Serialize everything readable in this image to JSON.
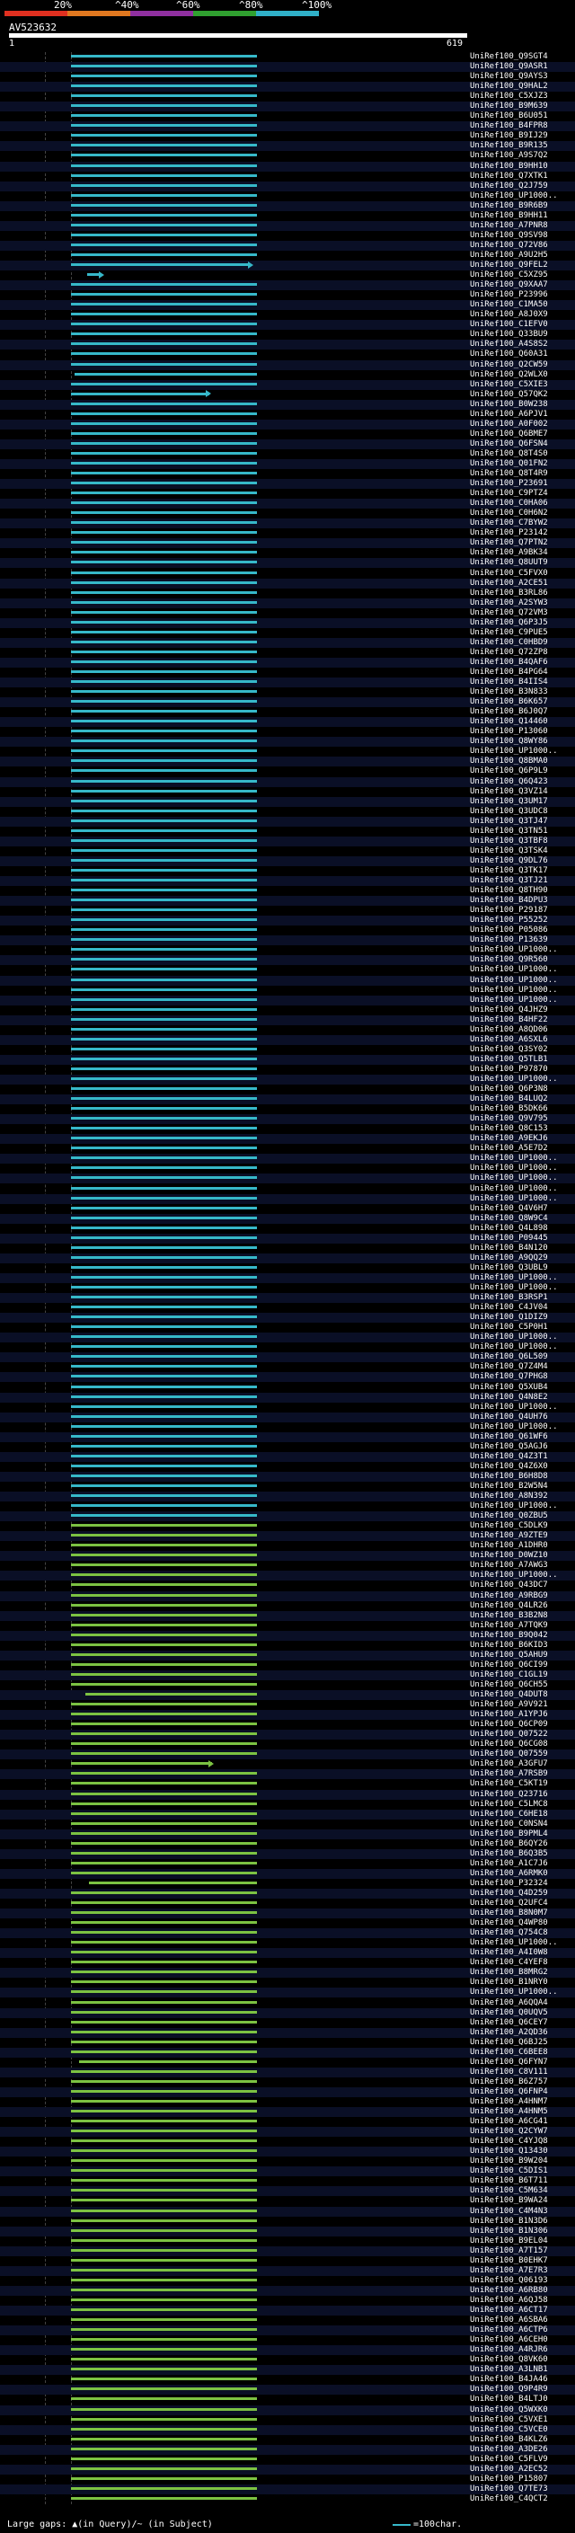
{
  "scale": {
    "labels": [
      "20%",
      "^40%",
      "^60%",
      "^80%",
      "^100%"
    ],
    "colors": [
      "#e03020",
      "#e07820",
      "#9030a0",
      "#30a030",
      "#30b0c8"
    ]
  },
  "query": {
    "id": "AV523632",
    "start": "1",
    "end": "619"
  },
  "legend": {
    "text": "Large gaps: ▲(in Query)/~ (in Subject)",
    "scale_text": "=100char."
  },
  "colors": {
    "cyan": "#36b8c9",
    "green": "#7cc242",
    "background": "#000000"
  },
  "hits": [
    "UniRef100_Q9SGT4",
    "UniRef100_Q9ASR1",
    "UniRef100_Q9AYS3",
    "UniRef100_Q9HAL2",
    "UniRef100_C5XJZ3",
    "UniRef100_B9M639",
    "UniRef100_B6U051",
    "UniRef100_B4FPR8",
    "UniRef100_B9IJ29",
    "UniRef100_B9R135",
    "UniRef100_A9S7Q2",
    "UniRef100_B9HH10",
    "UniRef100_Q7XTK1",
    "UniRef100_Q2J759",
    "UniRef100_UP1000..",
    "UniRef100_B9R6B9",
    "UniRef100_B9HH11",
    "UniRef100_A7PNR8",
    "UniRef100_Q9SV98",
    "UniRef100_Q72V86",
    "UniRef100_A9U2H5",
    "UniRef100_Q9FEL2",
    "UniRef100_C5XZ95",
    "UniRef100_Q9XAA7",
    "UniRef100_P23996",
    "UniRef100_C1MA50",
    "UniRef100_A8J0X9",
    "UniRef100_C1EFV0",
    "UniRef100_Q33BU9",
    "UniRef100_A4S8S2",
    "UniRef100_Q60A31",
    "UniRef100_Q2CW59",
    "UniRef100_Q2WLX0",
    "UniRef100_C5XIE3",
    "UniRef100_Q57QK2",
    "UniRef100_B0W238",
    "UniRef100_A6PJV1",
    "UniRef100_A0F002",
    "UniRef100_Q6BME7",
    "UniRef100_Q6FSN4",
    "UniRef100_Q8T4S0",
    "UniRef100_Q01FN2",
    "UniRef100_Q8T4R9",
    "UniRef100_P23691",
    "UniRef100_C9PTZ4",
    "UniRef100_C0HA06",
    "UniRef100_C0H6N2",
    "UniRef100_C7BYW2",
    "UniRef100_P23142",
    "UniRef100_Q7PTN2",
    "UniRef100_A9BK34",
    "UniRef100_Q8UUT9",
    "UniRef100_C5FVX0",
    "UniRef100_A2CE51",
    "UniRef100_B3RL86",
    "UniRef100_A2SYW3",
    "UniRef100_Q72VM3",
    "UniRef100_Q6P3J5",
    "UniRef100_C9PUE5",
    "UniRef100_C0HBD9",
    "UniRef100_Q72ZP8",
    "UniRef100_B4QAF6",
    "UniRef100_B4PG64",
    "UniRef100_B4IIS4",
    "UniRef100_B3N833",
    "UniRef100_B6K657",
    "UniRef100_B6J0Q7",
    "UniRef100_Q14460",
    "UniRef100_P13060",
    "UniRef100_Q8WY86",
    "UniRef100_UP1000..",
    "UniRef100_Q8BMA0",
    "UniRef100_Q6P9L9",
    "UniRef100_Q6Q423",
    "UniRef100_Q3VZ14",
    "UniRef100_Q3UM17",
    "UniRef100_Q3UDC8",
    "UniRef100_Q3TJ47",
    "UniRef100_Q3TN51",
    "UniRef100_Q3TBF8",
    "UniRef100_Q3TSK4",
    "UniRef100_Q9DL76",
    "UniRef100_Q3TK17",
    "UniRef100_Q3TJ21",
    "UniRef100_Q8TH90",
    "UniRef100_B4DPU3",
    "UniRef100_P29187",
    "UniRef100_P55252",
    "UniRef100_P05086",
    "UniRef100_P13639",
    "UniRef100_UP1000..",
    "UniRef100_Q9R560",
    "UniRef100_UP1000..",
    "UniRef100_UP1000..",
    "UniRef100_UP1000..",
    "UniRef100_UP1000..",
    "UniRef100_Q4JHZ9",
    "UniRef100_B4HF22",
    "UniRef100_A8QD06",
    "UniRef100_A6SXL6",
    "UniRef100_Q3SY02",
    "UniRef100_Q5TLB1",
    "UniRef100_P97870",
    "UniRef100_UP1000..",
    "UniRef100_Q6P3N8",
    "UniRef100_B4LUQ2",
    "UniRef100_B5DK66",
    "UniRef100_Q9V795",
    "UniRef100_Q8C153",
    "UniRef100_A9EKJ6",
    "UniRef100_A5E7D2",
    "UniRef100_UP1000..",
    "UniRef100_UP1000..",
    "UniRef100_UP1000..",
    "UniRef100_UP1000..",
    "UniRef100_UP1000..",
    "UniRef100_Q4V6H7",
    "UniRef100_Q8W9C4",
    "UniRef100_Q4L898",
    "UniRef100_P09445",
    "UniRef100_B4N120",
    "UniRef100_A9QQ29",
    "UniRef100_Q3UBL9",
    "UniRef100_UP1000..",
    "UniRef100_UP1000..",
    "UniRef100_B3RSP1",
    "UniRef100_C4JV04",
    "UniRef100_Q1DIZ9",
    "UniRef100_C5P0H1",
    "UniRef100_UP1000..",
    "UniRef100_UP1000..",
    "UniRef100_Q6L509",
    "UniRef100_Q7Z4M4",
    "UniRef100_Q7PHG8",
    "UniRef100_Q5XUB4",
    "UniRef100_Q4N8E2",
    "UniRef100_UP1000..",
    "UniRef100_Q4UH76",
    "UniRef100_UP1000..",
    "UniRef100_Q61WF6",
    "UniRef100_Q5AGJ6",
    "UniRef100_Q4Z3T1",
    "UniRef100_Q4Z6X0",
    "UniRef100_B6H8D8",
    "UniRef100_B2W5N4",
    "UniRef100_A8N392",
    "UniRef100_UP1000..",
    "UniRef100_Q0ZBU5",
    "UniRef100_C5DLK9",
    "UniRef100_A9ZTE9",
    "UniRef100_A1DHR0",
    "UniRef100_D0WZ10",
    "UniRef100_A7AWG3",
    "UniRef100_UP1000..",
    "UniRef100_Q43DC7",
    "UniRef100_A9RBG9",
    "UniRef100_Q4LR26",
    "UniRef100_B3B2N8",
    "UniRef100_A7TQK9",
    "UniRef100_B9Q042",
    "UniRef100_B6KID3",
    "UniRef100_Q5AHU9",
    "UniRef100_Q6CI99",
    "UniRef100_C1GL19",
    "UniRef100_Q6CH55",
    "UniRef100_Q4DUT8",
    "UniRef100_A9V921",
    "UniRef100_A1YPJ6",
    "UniRef100_Q6CP09",
    "UniRef100_Q07522",
    "UniRef100_Q6CG08",
    "UniRef100_Q07559",
    "UniRef100_A3GFU7",
    "UniRef100_A7RSB9",
    "UniRef100_C5KT19",
    "UniRef100_Q23716",
    "UniRef100_C5LMC8",
    "UniRef100_C6HE18",
    "UniRef100_C0NSN4",
    "UniRef100_B9PML4",
    "UniRef100_B6QY26",
    "UniRef100_B6Q3B5",
    "UniRef100_A1C7J6",
    "UniRef100_A6RMK0",
    "UniRef100_P32324",
    "UniRef100_Q4D259",
    "UniRef100_Q2UFC4",
    "UniRef100_B8N0M7",
    "UniRef100_Q4WP80",
    "UniRef100_Q754C8",
    "UniRef100_UP1000..",
    "UniRef100_A4I0W8",
    "UniRef100_C4YEF8",
    "UniRef100_B8MRG2",
    "UniRef100_B1NRY0",
    "UniRef100_UP1000..",
    "UniRef100_A6QQA4",
    "UniRef100_Q0UQV5",
    "UniRef100_Q6CEY7",
    "UniRef100_A2QD36",
    "UniRef100_Q6BJ25",
    "UniRef100_C6BEE8",
    "UniRef100_Q6FYN7",
    "UniRef100_C8V111",
    "UniRef100_B6Z757",
    "UniRef100_Q6FNP4",
    "UniRef100_A4HNM7",
    "UniRef100_A4HNM5",
    "UniRef100_A6CG41",
    "UniRef100_Q2CYW7",
    "UniRef100_C4YJQ8",
    "UniRef100_Q13430",
    "UniRef100_B9W204",
    "UniRef100_C5DIS1",
    "UniRef100_B6T711",
    "UniRef100_C5M634",
    "UniRef100_B9WA24",
    "UniRef100_C4M4N3",
    "UniRef100_B1N3D6",
    "UniRef100_B1N306",
    "UniRef100_B9EL04",
    "UniRef100_A7T157",
    "UniRef100_B0EHK7",
    "UniRef100_A7E7R3",
    "UniRef100_Q06193",
    "UniRef100_A6RB80",
    "UniRef100_A6QJ58",
    "UniRef100_A6CT17",
    "UniRef100_A6SBA6",
    "UniRef100_A6CTP6",
    "UniRef100_A6CEH0",
    "UniRef100_A4RJR6",
    "UniRef100_Q8VK60",
    "UniRef100_A3LNB1",
    "UniRef100_B4JA46",
    "UniRef100_Q9P4R9",
    "UniRef100_B4LTJ0",
    "UniRef100_Q5WXK0",
    "UniRef100_C5VXE1",
    "UniRef100_C5VCE0",
    "UniRef100_B4KLZ6",
    "UniRef100_A3DE26",
    "UniRef100_C5FLV9",
    "UniRef100_A2EC52",
    "UniRef100_P15807",
    "UniRef100_Q7TE73",
    "UniRef100_C4QCT2"
  ]
}
